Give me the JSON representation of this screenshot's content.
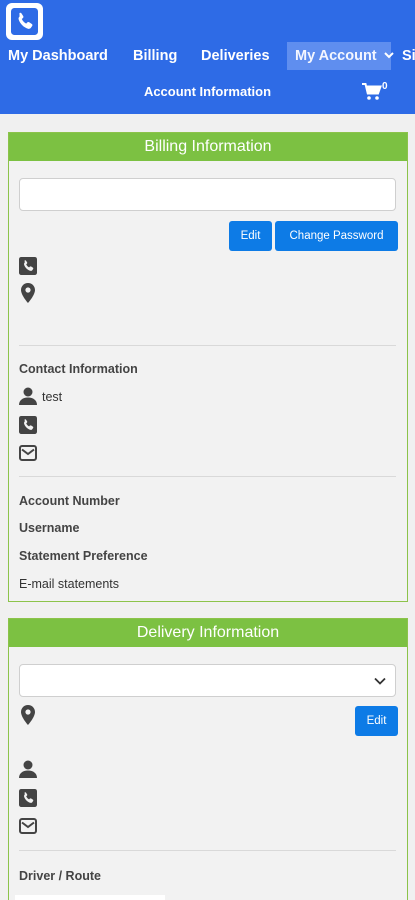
{
  "app": {
    "logo_icon": "phone-icon",
    "accent": "#2e6be6",
    "panel_accent": "#7cc142"
  },
  "nav": {
    "items": [
      {
        "label": "My Dashboard"
      },
      {
        "label": "Billing"
      },
      {
        "label": "Deliveries"
      },
      {
        "label": "My Account"
      },
      {
        "label": "Si"
      }
    ]
  },
  "subheader": {
    "title": "Account Information",
    "cart_count": "0"
  },
  "billing": {
    "title": "Billing Information",
    "select_value": "",
    "edit_label": "Edit",
    "change_password_label": "Change Password",
    "contact_heading": "Contact Information",
    "contact_name": "test",
    "account_number_label": "Account Number",
    "username_label": "Username",
    "statement_pref_label": "Statement Preference",
    "statement_pref_value": "E-mail statements"
  },
  "delivery": {
    "title": "Delivery Information",
    "select_value": "",
    "edit_label": "Edit",
    "driver_route_label": "Driver / Route"
  }
}
